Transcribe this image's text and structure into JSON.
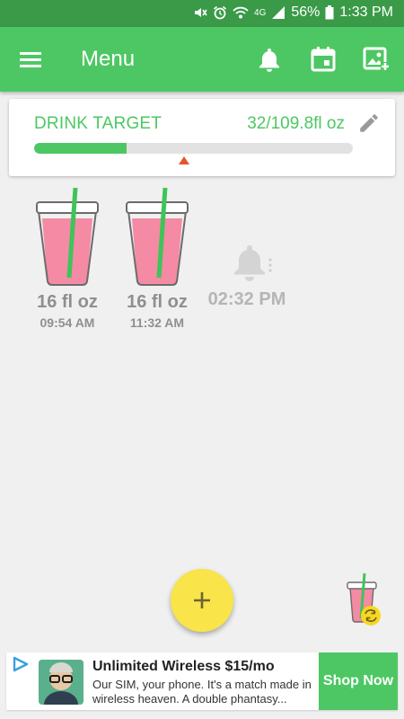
{
  "status_bar": {
    "icons": [
      "mute-icon",
      "alarm-icon",
      "wifi-icon",
      "signal-4g-icon",
      "battery-icon"
    ],
    "network": "4G",
    "battery": "56%",
    "time": "1:33 PM"
  },
  "app_bar": {
    "title": "Menu",
    "actions": [
      "bell-icon",
      "calendar-icon",
      "add-photo-icon"
    ]
  },
  "target": {
    "label": "DRINK TARGET",
    "value": "32/109.8fl oz",
    "progress": 0.29,
    "marker": 0.47
  },
  "entries": [
    {
      "amount": "16 fl oz",
      "time": "09:54 AM"
    },
    {
      "amount": "16 fl oz",
      "time": "11:32 AM"
    }
  ],
  "reminder": {
    "time": "02:32 PM"
  },
  "colors": {
    "primary": "#4dc763",
    "status_bar": "#3a9a48",
    "fab": "#f9e449",
    "drink": "#f48aa3",
    "marker": "#e8542a"
  },
  "ad": {
    "title": "Unlimited Wireless $15/mo",
    "body": "Our SIM, your phone. It's a match made in wireless heaven. A double phantasy...",
    "cta": "Shop Now"
  }
}
